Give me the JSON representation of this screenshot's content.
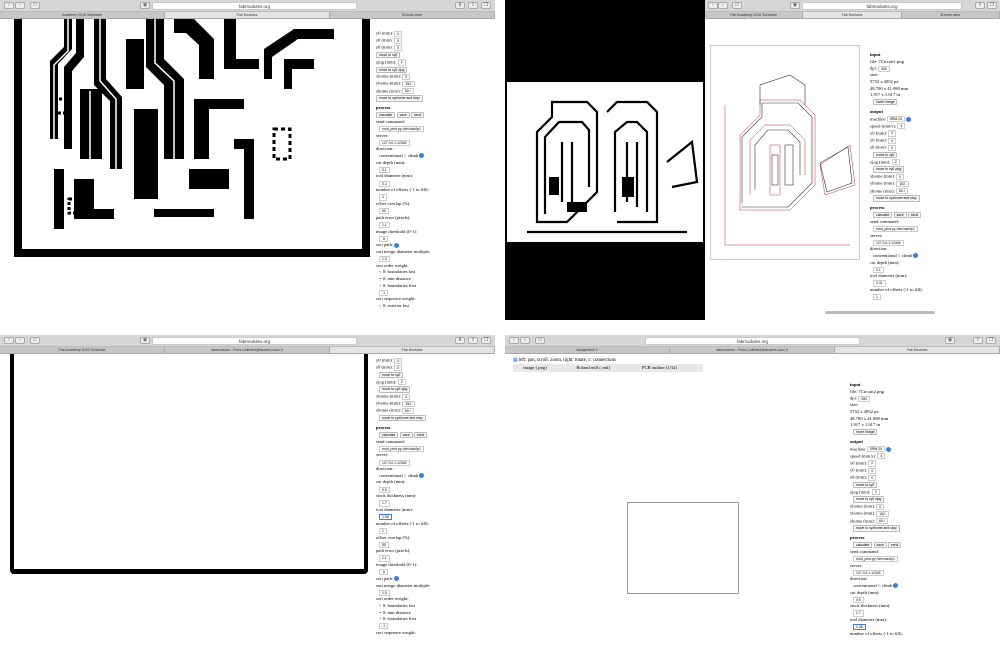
{
  "shots": {
    "tl": {
      "url": "fabmodules.org",
      "tabs": [
        "Academy 2016 Schedule",
        "Fab Modules",
        "fil.tools view"
      ],
      "active": 1,
      "panel": [
        [
          "y0 (mm):",
          "0"
        ],
        [
          "z0 (mm):",
          "0"
        ],
        [
          "z0 (mm):",
          "0"
        ]
      ]
    },
    "tr": {
      "url": "fabmodules.org",
      "tabs": [
        "Fab Academy 2016 Schedule",
        "Fab Modules",
        "fil.tools view"
      ],
      "active": 1
    },
    "bl": {
      "url": "fabmodules.org",
      "tabs": [
        "Fab Academy 2016 Schedule",
        "fabmodules - Fees.Unilisted@student.ucsc.fi",
        "Fab Modules"
      ],
      "active": 2
    },
    "br": {
      "url": "fabmodules.org",
      "tabs": [
        "Assignment 2",
        "fabmodules - Fees.Unilisted@student.ucsc.fi",
        "Fab Modules"
      ],
      "active": 2
    }
  },
  "toolbar": {
    "hint": "left: pan, scroll: zoom, right: rotate, c: connections",
    "items": [
      "image (.png)",
      "Roland mill (.rml)",
      "PCB outline (1/32)"
    ]
  },
  "input": {
    "title": "input",
    "file": "file: 7Circuit1.png",
    "file2": "file: 7Circuit2.png",
    "dpi": "dpi:",
    "dpi_v": "500",
    "size": "size:",
    "px": "5752 x 4852 px",
    "mm": "48.700 x 41.080 mm",
    "in": "1.917 x 1.617 in",
    "invert": "invert image"
  },
  "output": {
    "title": "output",
    "machine": "machine",
    "machine_v": "SRM-20",
    "speed": "speed (mm/s):",
    "speed_v": "4",
    "x0": "x0 (mm):",
    "y0": "y0 (mm):",
    "z0": "z0 (mm):",
    "zero": "0",
    "move_xy0": "move to xy0",
    "zjog": "zjog (mm):",
    "zjog_v": "2",
    "move_xyz": "move to xy0 zjog",
    "xhome": "xhome (mm):",
    "xhome_v": "0",
    "yhome": "yhome (mm):",
    "yhome_v": "152.",
    "zhome": "zhome (mm):",
    "zhome_v": "60.!",
    "move_home": "move to xyzhome and stop"
  },
  "process": {
    "title": "process",
    "calculate": "calculate",
    "save": "save",
    "send": "send",
    "send_cmd": "send command:",
    "cmd_v": "mod_print.py /dev/usb/lp1",
    "server": "server:",
    "server_v": "127.0.0.1:12345",
    "direction": "direction:",
    "conventional": "conventional",
    "climb": "climb",
    "cut_depth": "cut depth (mm):",
    "cut_v": "0.1",
    "cut_v2": "0.6",
    "stock": "stock thickness (mm):",
    "stock_v": "1.7",
    "tool": "tool diameter (mm):",
    "tool_v": "0.4",
    "tool_v2": "0.31",
    "tool_v3": "1.08",
    "offsets": "number of offsets (-1 to fill):",
    "offsets_v": "4",
    "offsets_v2": "1",
    "overlap": "offset overlap (%):",
    "overlap_v": "50",
    "path_err": "path error (pixels):",
    "path_v": "1.1",
    "thresh": "image threshold (0-1):",
    "thresh_v": ".5",
    "sort": "sort path:",
    "merge": "sort merge diameter multiple:",
    "merge_v": "1.5",
    "order": "sort order weight:",
    "o1": "< 0: boundaries last",
    "o2": "= 0: min distance",
    "o3": "> 0: boundaries first",
    "order_v": "-1",
    "seq": "sort sequence weight:",
    "s1": "< 0: exterior last"
  }
}
